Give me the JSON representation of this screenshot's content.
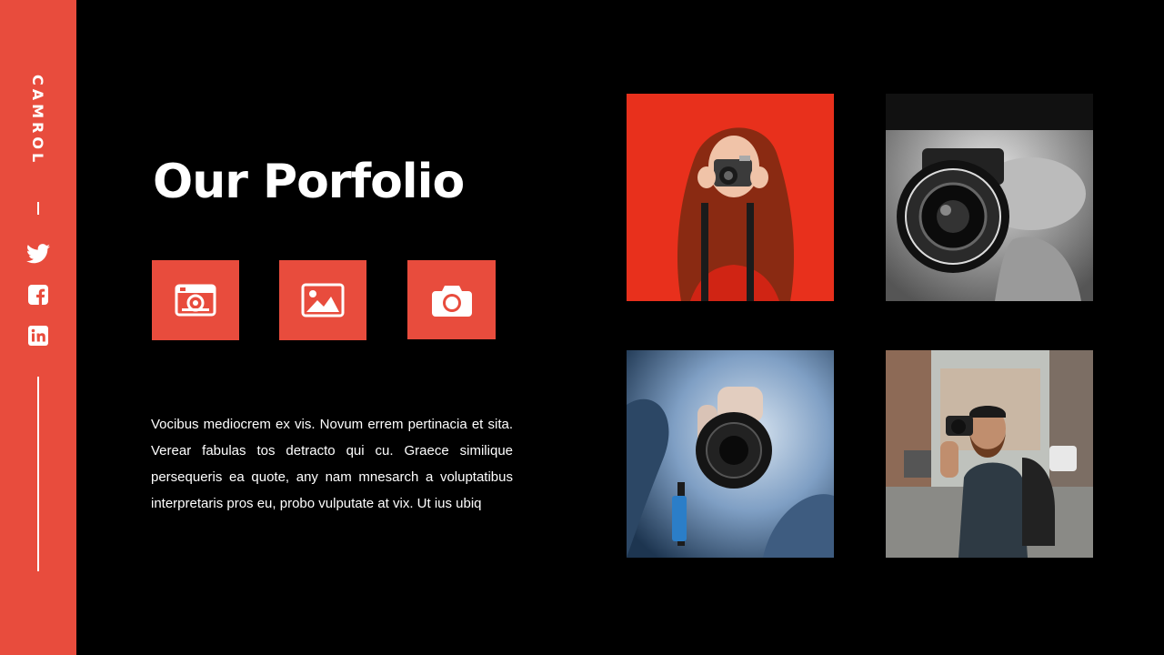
{
  "sidebar": {
    "brand": "CAMROL",
    "social": [
      "twitter-icon",
      "facebook-icon",
      "linkedin-icon"
    ],
    "accent": "#e84c3d"
  },
  "main": {
    "title": "Our Porfolio",
    "feature_icons": [
      "photo-frame-icon",
      "image-icon",
      "camera-icon"
    ],
    "body": "Vocibus mediocrem ex vis. Novum errem pertinacia et sita. Verear fabulas tos detracto qui cu. Graece similique persequeris ea quote, any nam mnesarch  a voluptatibus interpretaris pros eu, probo vulputate at vix. Ut ius ubiq"
  },
  "gallery": {
    "photos": [
      {
        "subject": "woman with red hair holding a camera",
        "background": "#e8301c"
      },
      {
        "subject": "black and white close-up of camera lens",
        "background": "#cfcfcf"
      },
      {
        "subject": "hands holding a camera in blue smoke",
        "background": "#6f8fb5"
      },
      {
        "subject": "bearded man photographing on a city street",
        "background": "#a8aaa6"
      }
    ]
  }
}
